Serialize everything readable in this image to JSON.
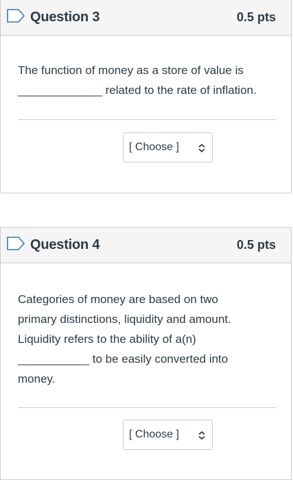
{
  "questions": [
    {
      "title": "Question 3",
      "points": "0.5 pts",
      "text_line1": "The function of money as a store of value is",
      "text_line2": "_____________ related to the rate of inflation.",
      "select_value": "[ Choose ]"
    },
    {
      "title": "Question 4",
      "points": "0.5 pts",
      "text_line1": "Categories of money are based on two",
      "text_line2": "primary distinctions, liquidity and amount.",
      "text_line3": "Liquidity refers to the ability of a(n)",
      "text_line4": "___________ to be easily converted into",
      "text_line5": "money.",
      "select_value": "[ Choose ]"
    }
  ],
  "icons": {
    "flag": "flag-outline-icon",
    "select_arrow": "chevron-up-down-icon"
  },
  "colors": {
    "text": "#2d3b45",
    "border": "#c7cdd1",
    "header_bg": "#f5f5f5",
    "flag": "#3e78b3"
  }
}
